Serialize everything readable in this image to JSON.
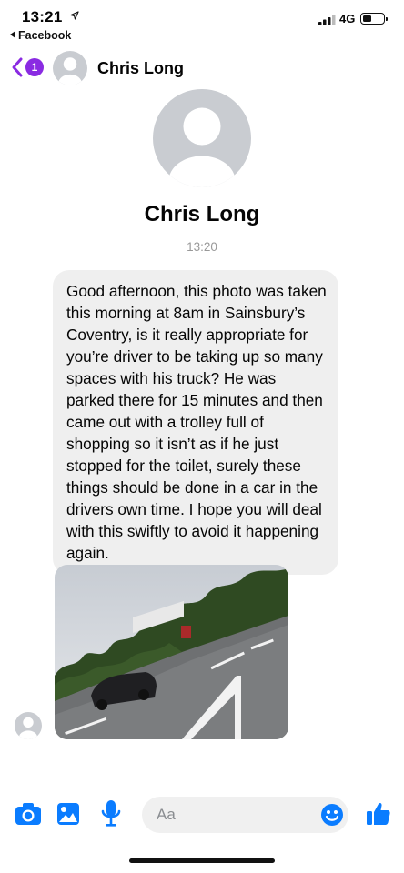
{
  "status_bar": {
    "time": "13:21",
    "back_app": "Facebook",
    "network": "4G",
    "icons": [
      "location-arrow-icon",
      "signal-icon",
      "battery-icon"
    ]
  },
  "header": {
    "unread_count": "1",
    "contact_name": "Chris Long",
    "icons": [
      "back-chevron-icon"
    ]
  },
  "profile": {
    "name": "Chris Long"
  },
  "conversation": {
    "timestamp": "13:20",
    "message_text": "Good afternoon, this photo was taken this morning at 8am in Sainsbury’s Coventry, is it really appropriate for you’re driver to be taking up so many spaces with his truck? He was parked there for 15 minutes and then came out with a trolley full of shopping so it isn’t as if he just stopped for the toilet, surely these things should be done in a car in the drivers own time. I hope you will deal with this swiftly to avoid it happening again."
  },
  "composer": {
    "placeholder": "Aa",
    "icons": [
      "camera-icon",
      "gallery-icon",
      "microphone-icon",
      "emoji-icon",
      "thumbs-up-icon"
    ]
  },
  "colors": {
    "accent": "#0a7cff",
    "badge": "#8a2be2",
    "bubble": "#efefef",
    "avatar_bg": "#c9ccd1"
  }
}
